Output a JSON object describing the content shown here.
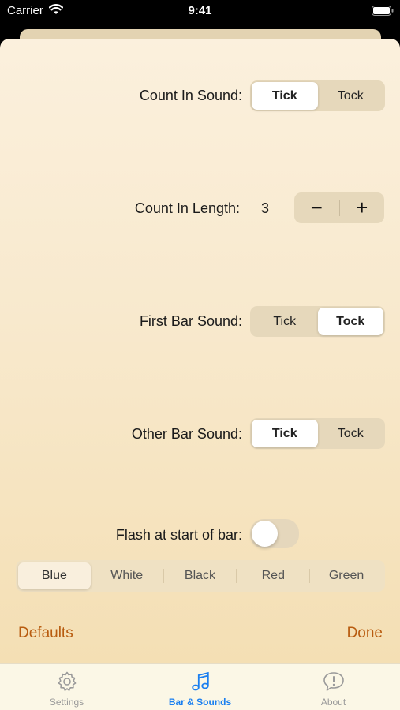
{
  "status_bar": {
    "carrier": "Carrier",
    "time": "9:41"
  },
  "settings": {
    "count_in_sound": {
      "label": "Count In Sound:",
      "options": [
        "Tick",
        "Tock"
      ],
      "selected": "Tick"
    },
    "count_in_length": {
      "label": "Count In Length:",
      "value": "3",
      "decrement": "−",
      "increment": "+"
    },
    "first_bar_sound": {
      "label": "First Bar Sound:",
      "options": [
        "Tick",
        "Tock"
      ],
      "selected": "Tock"
    },
    "other_bar_sound": {
      "label": "Other Bar Sound:",
      "options": [
        "Tick",
        "Tock"
      ],
      "selected": "Tick"
    },
    "flash": {
      "label": "Flash at start of bar:",
      "on": false
    },
    "flash_color": {
      "options": [
        "Blue",
        "White",
        "Black",
        "Red",
        "Green"
      ],
      "selected": "Blue"
    }
  },
  "footer": {
    "defaults": "Defaults",
    "done": "Done"
  },
  "tabs": [
    {
      "label": "Settings",
      "icon": "gear-icon",
      "active": false
    },
    {
      "label": "Bar & Sounds",
      "icon": "music-note-icon",
      "active": true
    },
    {
      "label": "About",
      "icon": "speech-bubble-icon",
      "active": false
    }
  ],
  "colors": {
    "accent": "#b85c10",
    "tab_active": "#1a7ff0"
  }
}
